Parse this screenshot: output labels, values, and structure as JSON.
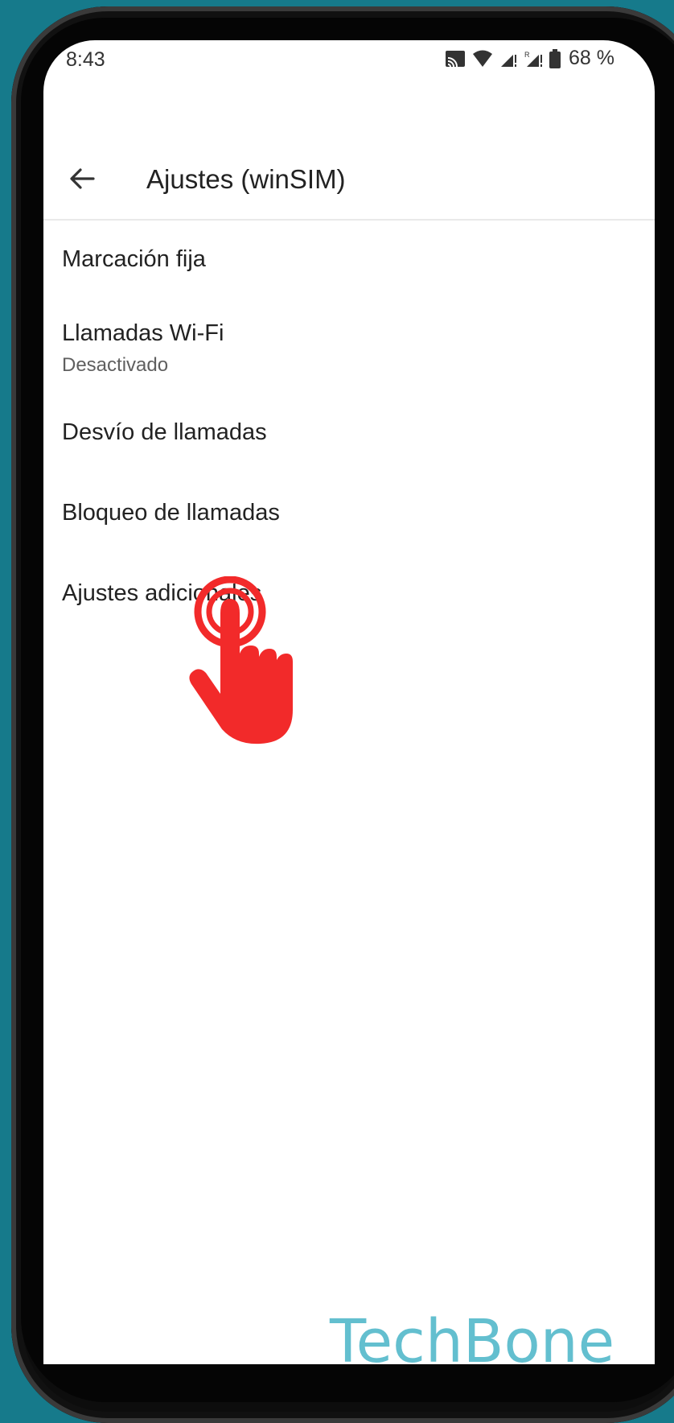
{
  "status_bar": {
    "time": "8:43",
    "battery": "68 %"
  },
  "app_bar": {
    "title": "Ajustes (winSIM)"
  },
  "settings_items": [
    {
      "title": "Marcación fija"
    },
    {
      "title": "Llamadas Wi-Fi",
      "subtitle": "Desactivado"
    },
    {
      "title": "Desvío de llamadas"
    },
    {
      "title": "Bloqueo de llamadas"
    },
    {
      "title": "Ajustes adicionales"
    }
  ],
  "overlay": {
    "icon": "tap-hand-icon",
    "color": "#f22a2a"
  },
  "watermark": "TechBone"
}
